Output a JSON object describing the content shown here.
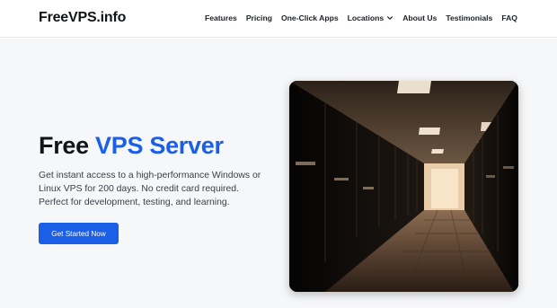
{
  "header": {
    "logo": "FreeVPS.info",
    "nav": [
      {
        "label": "Features"
      },
      {
        "label": "Pricing"
      },
      {
        "label": "One-Click Apps"
      },
      {
        "label": "Locations",
        "has_dropdown": true
      },
      {
        "label": "About Us"
      },
      {
        "label": "Testimonials"
      },
      {
        "label": "FAQ"
      }
    ]
  },
  "hero": {
    "headline_part1": "Free",
    "headline_part2": "VPS Server",
    "description": "Get instant access to a high-performance Windows or Linux VPS for 200 days. No credit card required. Perfect for development, testing, and learning.",
    "cta_label": "Get Started Now",
    "image_icon": "server-room-photo"
  },
  "colors": {
    "accent": "#1a5fe6",
    "text": "#111418",
    "muted_text": "#3b4047",
    "hero_bg": "#f6f7f9",
    "header_border": "#e6e8eb"
  }
}
